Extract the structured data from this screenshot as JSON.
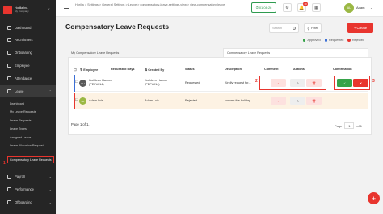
{
  "sidebar": {
    "company_name": "Horilla Inc.",
    "company_sub": "My Company",
    "items": [
      {
        "label": "Dashboard"
      },
      {
        "label": "Recruitment"
      },
      {
        "label": "Onboarding"
      },
      {
        "label": "Employee"
      },
      {
        "label": "Attendance"
      },
      {
        "label": "Leave"
      }
    ],
    "leave_sub_items": [
      {
        "label": "Dashboard"
      },
      {
        "label": "My Leave Requests"
      },
      {
        "label": "Leave Requests"
      },
      {
        "label": "Leave Types"
      },
      {
        "label": "Assigned Leave"
      },
      {
        "label": "Leave Allocation Request"
      },
      {
        "label": "Compensatory Leave Requests"
      }
    ],
    "items_bottom": [
      {
        "label": "Payroll"
      },
      {
        "label": "Performance"
      },
      {
        "label": "Offboarding"
      }
    ],
    "step_marker": "1"
  },
  "topbar": {
    "breadcrumbs": "Horilla > Settings > General Settings > Leave > compensatory-leave-settings-view > view-compensatory-leave",
    "timer": "⏱ 01:08:26",
    "notif_count": "10",
    "user_initials": "AL",
    "user_name": "Adam"
  },
  "page": {
    "title": "Compensatory Leave Requests",
    "search_placeholder": "Search",
    "filter_label": "Filter",
    "create_label": "+ Create",
    "legend": [
      {
        "label": "Approved",
        "color": "#37a34a"
      },
      {
        "label": "Requested",
        "color": "#3b6fd6"
      },
      {
        "label": "Rejected",
        "color": "#e8352e"
      }
    ],
    "tabs": [
      {
        "label": "My Compensatory Leave Requests"
      },
      {
        "label": "Compensatory Leave Requests"
      }
    ]
  },
  "table": {
    "headers": {
      "employee": "Employee",
      "requested_days": "Requested Days",
      "created_by": "Created By",
      "status": "Status",
      "description": "Description",
      "comment": "Comment",
      "actions": "Actions",
      "confirmation": "Confirmation"
    },
    "rows": [
      {
        "initials": "KH",
        "employee": "Kathleen Hanner (PEP#014)",
        "requested_days": "",
        "created_by": "Kathleen Hanner (PEP#014)",
        "status": "Requested",
        "description": "Kindly request for...",
        "avatar_color": "#5a5a5a",
        "bar_color": "#3b6fd6"
      },
      {
        "initials": "AL",
        "employee": "Adam Luis",
        "requested_days": "",
        "created_by": "Adam Luis",
        "status": "Rejected",
        "description": "convert the holiday...",
        "avatar_color": "#9bb844",
        "bar_color": "#e8352e"
      }
    ],
    "markers": {
      "comment_step": "2",
      "confirm_step": "3"
    },
    "page_info": "Page 1 of 1.",
    "pager": {
      "page": "Page",
      "current": "1",
      "of": "of 1"
    }
  },
  "colors": {
    "accent": "#e8352e",
    "success": "#37a34a",
    "sidebar_bg": "#252525"
  }
}
